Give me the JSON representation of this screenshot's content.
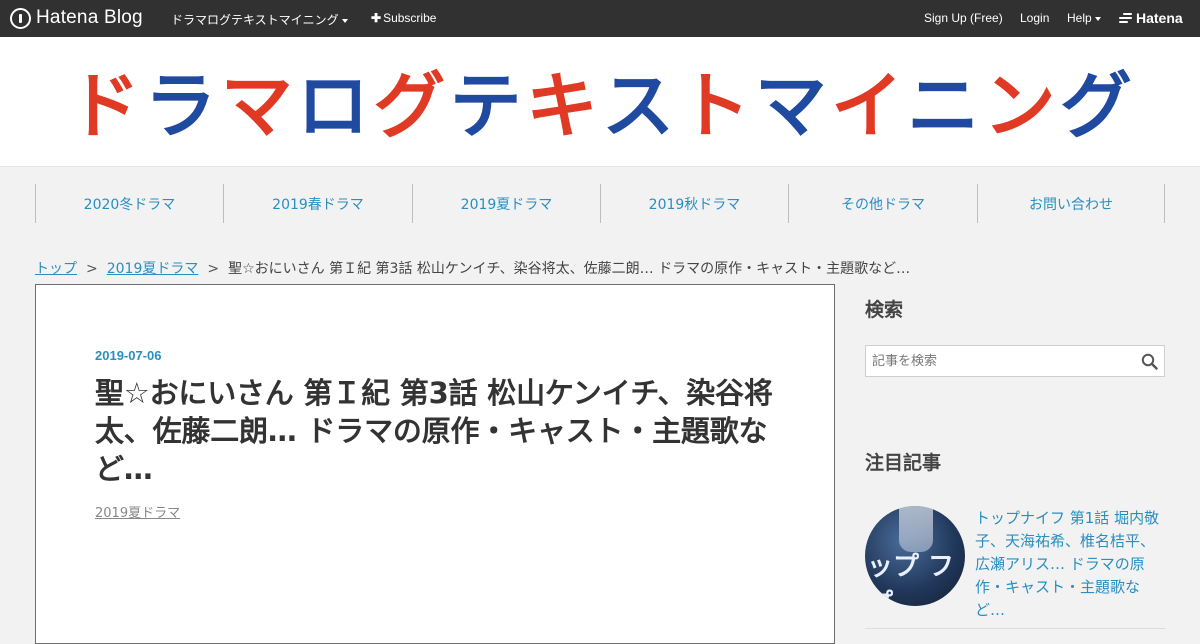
{
  "topbar": {
    "logo": "Hatena Blog",
    "blog_name": "ドラマログテキストマイニング",
    "subscribe": "Subscribe",
    "signup": "Sign Up (Free)",
    "login": "Login",
    "help": "Help",
    "hatena": "Hatena"
  },
  "header": {
    "banner_chars": [
      "ド",
      "ラ",
      "マ",
      "ロ",
      "グ",
      "テ",
      "キ",
      "ス",
      "ト",
      "マ",
      "イ",
      "ニ",
      "ン",
      "グ"
    ],
    "banner_colors": {
      "red": "#e03a24",
      "blue": "#1f4aa0"
    }
  },
  "nav": {
    "items": [
      "2020冬ドラマ",
      "2019春ドラマ",
      "2019夏ドラマ",
      "2019秋ドラマ",
      "その他ドラマ",
      "お問い合わせ"
    ]
  },
  "breadcrumb": {
    "home": "トップ",
    "category": "2019夏ドラマ",
    "separator": ">",
    "current": "聖☆おにいさん 第Ｉ紀 第3話 松山ケンイチ、染谷将太、佐藤二朗… ドラマの原作・キャスト・主題歌など…"
  },
  "article": {
    "date": "2019-07-06",
    "title": "聖☆おにいさん 第Ｉ紀 第3話 松山ケンイチ、染谷将太、佐藤二朗… ドラマの原作・キャスト・主題歌など…",
    "category": "2019夏ドラマ"
  },
  "sidebar": {
    "search_heading": "検索",
    "search_placeholder": "記事を検索",
    "featured_heading": "注目記事",
    "featured_title": "トップナイフ 第1話 堀内敬子、天海祐希、椎名桔平、広瀬アリス… ドラマの原作・キャスト・主題歌など…",
    "featured_thumb_text": "ップ フ プ"
  },
  "colors": {
    "link": "#2a8ec0",
    "topbar_bg": "#313131",
    "page_bg": "#f2f2f2"
  }
}
